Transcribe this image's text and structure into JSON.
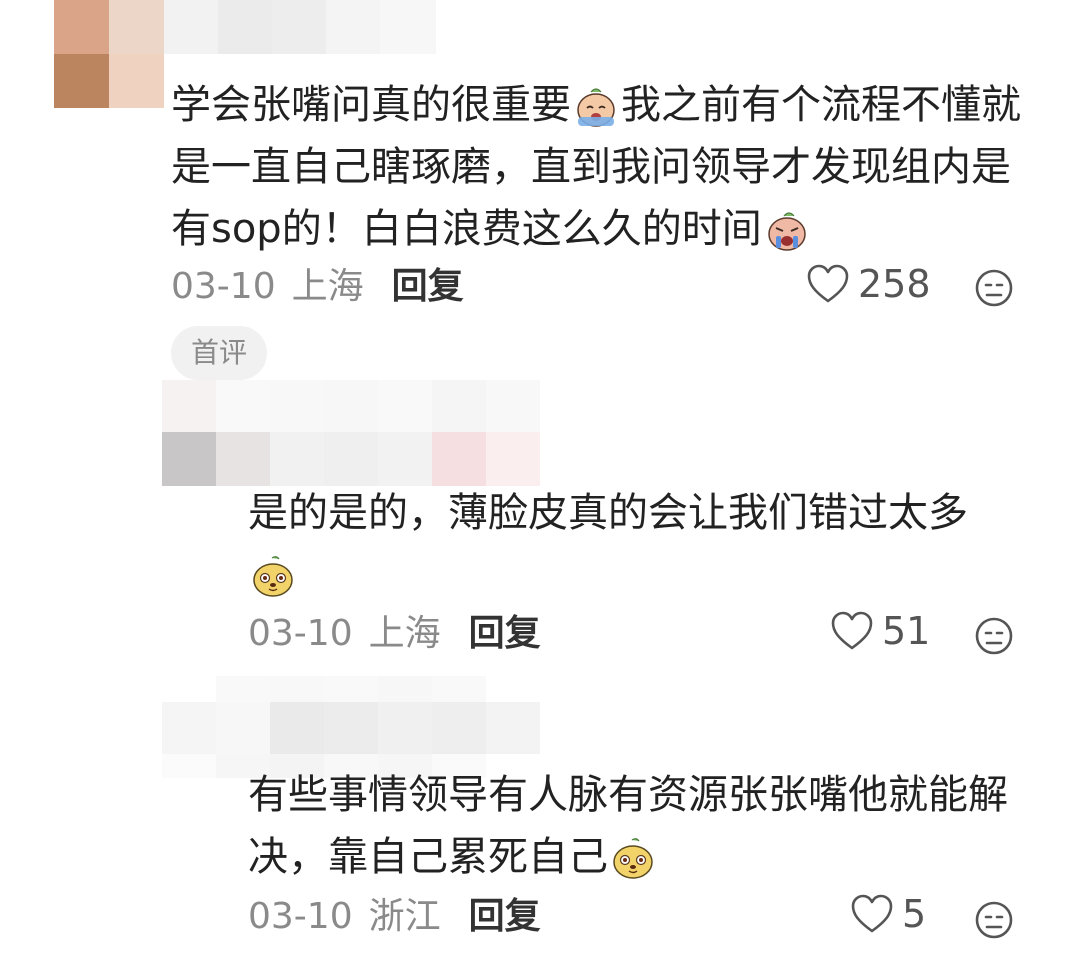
{
  "comments": [
    {
      "text_parts": [
        "学会张嘴问真的很重要",
        "我之前有个流程不懂就是一直自己瞎琢磨，直到我问领导才发现组内是有sop的！白白浪费这么久的时间",
        ""
      ],
      "emojis": [
        "crying-emoji",
        "crying-face-emoji"
      ],
      "date": "03-10",
      "location": "上海",
      "reply_label": "回复",
      "likes": "258",
      "badge": "首评"
    },
    {
      "text_parts": [
        "是的是的，薄脸皮真的会让我们错过太多",
        ""
      ],
      "emojis": [
        "dog-face-emoji"
      ],
      "date": "03-10",
      "location": "上海",
      "reply_label": "回复",
      "likes": "51"
    },
    {
      "text_parts": [
        "有些事情领导有人脉有资源张张嘴他就能解决，靠自己累死自己",
        ""
      ],
      "emojis": [
        "dog-face-emoji"
      ],
      "date": "03-10",
      "location": "浙江",
      "reply_label": "回复",
      "likes": "5"
    }
  ],
  "colors": {
    "text": "#222222",
    "meta": "#8a8a8a",
    "badge_bg": "#f1f1f1"
  },
  "icons": [
    "heart-outline-icon",
    "dislike-face-icon",
    "mosaic-avatar"
  ]
}
